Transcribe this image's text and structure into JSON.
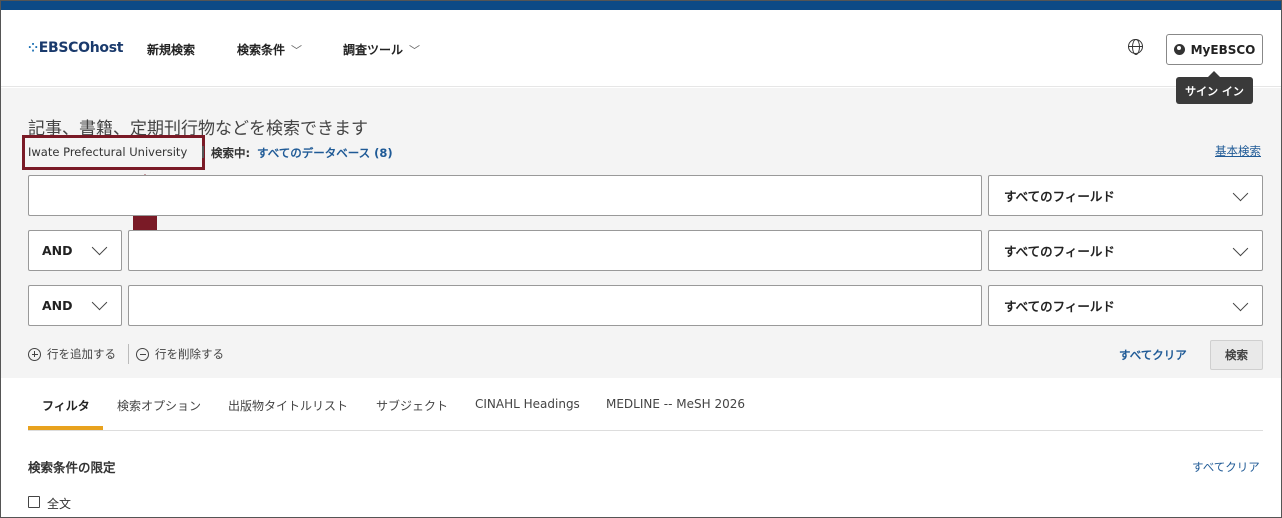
{
  "header": {
    "logo_text": "EBSCOhost",
    "nav": [
      {
        "label": "新規検索"
      },
      {
        "label": "検索条件"
      },
      {
        "label": "調査ツール"
      }
    ],
    "myebsco_label": "MyEBSCO",
    "tooltip": "サイン イン"
  },
  "search": {
    "headline": "記事、書籍、定期刊行物などを検索できます",
    "institution": "Iwate Prefectural University",
    "searching_label": "検索中:",
    "databases_link": "すべてのデータベース (8)",
    "basic_search_link": "基本検索",
    "rows": [
      {
        "value": "",
        "field": "すべてのフィールド"
      },
      {
        "operator": "AND",
        "value": "",
        "field": "すべてのフィールド"
      },
      {
        "operator": "AND",
        "value": "",
        "field": "すべてのフィールド"
      }
    ],
    "add_row": "行を追加する",
    "remove_row": "行を削除する",
    "clear_all": "すべてクリア",
    "search_button": "検索"
  },
  "tabs": [
    {
      "label": "フィルタ",
      "active": true
    },
    {
      "label": "検索オプション"
    },
    {
      "label": "出版物タイトルリスト"
    },
    {
      "label": "サブジェクト"
    },
    {
      "label": "CINAHL Headings"
    },
    {
      "label": "MEDLINE -- MeSH 2026"
    }
  ],
  "limiters": {
    "heading": "検索条件の限定",
    "clear_all": "すべてクリア",
    "fulltext_label": "全文"
  },
  "colors": {
    "brand_blue": "#0d4a86",
    "link_blue": "#1f5a96",
    "annotation_red": "#7a1a26",
    "tab_accent": "#e8a21e"
  }
}
